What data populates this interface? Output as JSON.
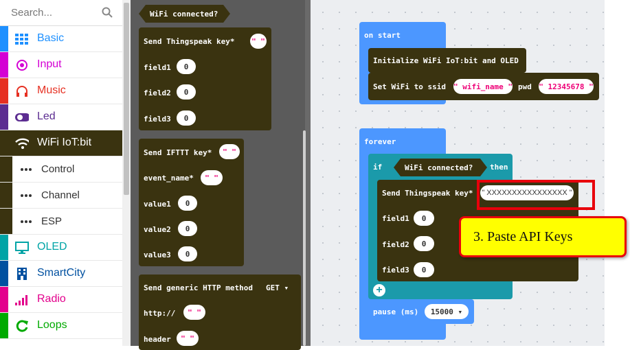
{
  "search": {
    "placeholder": "Search..."
  },
  "categories": [
    {
      "label": "Basic",
      "color": "#1e90ff"
    },
    {
      "label": "Input",
      "color": "#d400d4"
    },
    {
      "label": "Music",
      "color": "#e63022"
    },
    {
      "label": "Led",
      "color": "#5c2d91"
    },
    {
      "label": "WiFi IoT:bit",
      "color": "#3a3310"
    },
    {
      "label": "Control"
    },
    {
      "label": "Channel"
    },
    {
      "label": "ESP"
    },
    {
      "label": "OLED",
      "color": "#00a4a6"
    },
    {
      "label": "SmartCity",
      "color": "#0050a0"
    },
    {
      "label": "Radio",
      "color": "#e3008c"
    },
    {
      "label": "Loops",
      "color": "#00aa00"
    }
  ],
  "flyout": {
    "wifi_connected": "WiFi connected?",
    "thingspeak": "Send Thingspeak key*",
    "field1": "field1",
    "field2": "field2",
    "field3": "field3",
    "zero": "0",
    "ifttt": "Send IFTTT key*",
    "event_name": "event_name*",
    "value1": "value1",
    "value2": "value2",
    "value3": "value3",
    "http_method": "Send generic HTTP method",
    "method_value": "GET ▾",
    "http": "http://",
    "header": "header",
    "empty_str": "\" \""
  },
  "workspace": {
    "on_start": "on start",
    "init": "Initialize WiFi IoT:bit and OLED",
    "set_wifi": "Set WiFi to ssid",
    "ssid": "\" wifi_name \"",
    "pwd_label": "pwd",
    "pwd": "\" 12345678 \"",
    "forever": "forever",
    "if": "if",
    "condition": "WiFi connected?",
    "then": "then",
    "thingspeak": "Send Thingspeak key*",
    "key": "\" XXXXXXXXXXXXXXXX \"",
    "field1": "field1",
    "field2": "field2",
    "field3": "field3",
    "zero": "0",
    "pause": "pause (ms)",
    "pause_value": "15000 ▾",
    "plus": "+"
  },
  "callout": "3. Paste API Keys"
}
